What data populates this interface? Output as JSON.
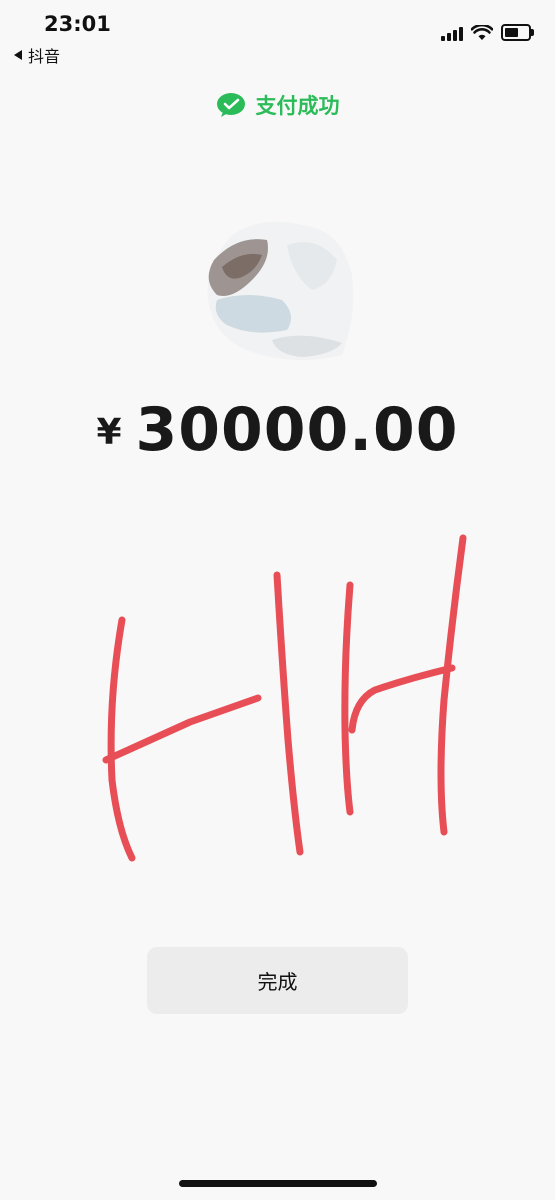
{
  "status_bar": {
    "time": "23:01",
    "back_app": "抖音",
    "icons": [
      "cellular-signal-icon",
      "wifi-icon",
      "battery-icon"
    ]
  },
  "header": {
    "title": "支付成功",
    "icon": "wechat-pay-icon",
    "accent_color": "#2bbb59"
  },
  "payment": {
    "currency_symbol": "¥",
    "amount": "30000.00"
  },
  "actions": {
    "done_label": "完成"
  }
}
